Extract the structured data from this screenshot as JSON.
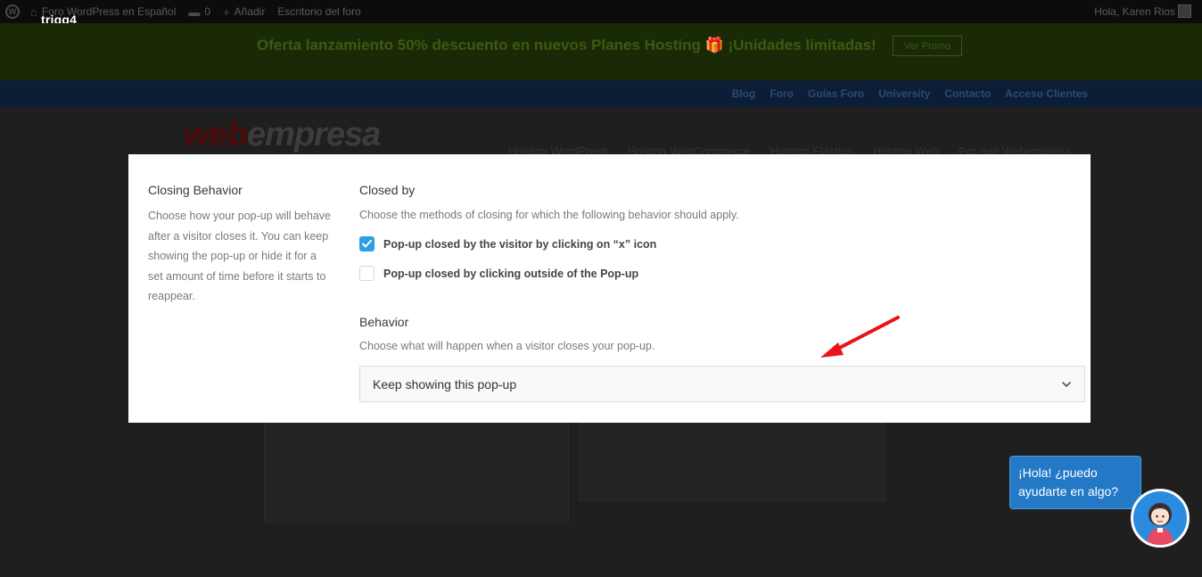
{
  "admin_bar": {
    "site": "Foro WordPress en Español",
    "comments_count": "0",
    "add_new": "Añadir",
    "dashboard": "Escritorio del foro",
    "greeting": "Hola, Karen Rios"
  },
  "overlay_label": "trigg4",
  "promo": {
    "text": "Oferta lanzamiento 50% descuento en nuevos Planes Hosting 🎁 ¡Unidades limitadas!",
    "button": "Ver Promo"
  },
  "top_nav": [
    "Blog",
    "Foro",
    "Guías Foro",
    "University",
    "Contacto",
    "Acceso Clientes"
  ],
  "logo": {
    "part1": "web",
    "part2": "empresa"
  },
  "main_nav": [
    "Hosting WordPress",
    "Hosting WooCommerce",
    "Hosting Elástico",
    "Hosting Web",
    "Por qué Webempresa"
  ],
  "modal": {
    "side_title": "Closing Behavior",
    "side_description": "Choose how your pop-up will behave after a visitor closes it. You can keep showing the pop-up or hide it for a set amount of time before it starts to reappear.",
    "closed_by": {
      "title": "Closed by",
      "description": "Choose the methods of closing for which the following behavior should apply.",
      "options": [
        {
          "label": "Pop-up closed by the visitor by clicking on “x” icon",
          "checked": true
        },
        {
          "label": "Pop-up closed by clicking outside of the Pop-up",
          "checked": false
        }
      ]
    },
    "behavior": {
      "title": "Behavior",
      "description": "Choose what will happen when a visitor closes your pop-up.",
      "selected": "Keep showing this pop-up"
    }
  },
  "chat": {
    "line1": "¡Hola! ¿puedo",
    "line2": "ayudarte en algo?"
  },
  "colors": {
    "accent": "#2f9de1",
    "annotation_arrow": "#e8141a",
    "chat_blue": "#2479c6"
  }
}
